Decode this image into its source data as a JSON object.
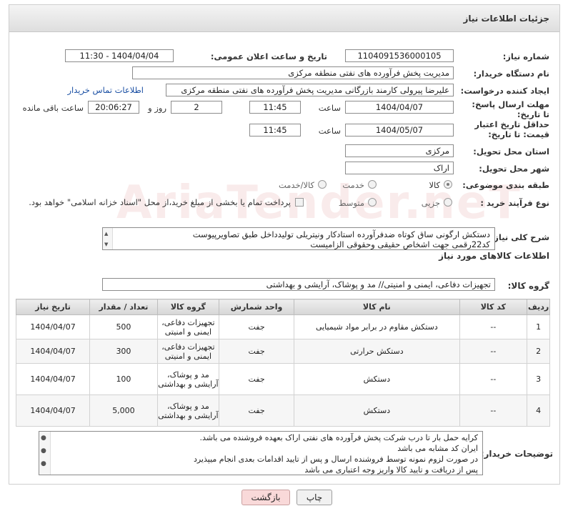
{
  "header": {
    "title": "جزئیات اطلاعات نیاز"
  },
  "fields": {
    "need_number_label": "شماره نیاز:",
    "need_number": "1104091536000105",
    "announce_label": "تاریخ و ساعت اعلان عمومی:",
    "announce_value": "1404/04/04 - 11:30",
    "buyer_org_label": "نام دستگاه خریدار:",
    "buyer_org": "مدیریت پخش فرآورده های نفتی منطقه مرکزی",
    "creator_label": "ایجاد کننده درخواست:",
    "creator": "علیرضا پیرولی کارمند بازرگانی مدیریت پخش فرآورده های نفتی منطقه مرکزی",
    "contact_link": "اطلاعات تماس خریدار",
    "reply_deadline_label": "مهلت ارسال پاسخ: تا تاریخ:",
    "reply_date": "1404/04/07",
    "time_label": "ساعت",
    "reply_time": "11:45",
    "days_value": "2",
    "days_label": "روز و",
    "remaining_time": "20:06:27",
    "remaining_label": "ساعت باقی مانده",
    "price_deadline_label": "حداقل تاریخ اعتبار قیمت: تا تاریخ:",
    "price_date": "1404/05/07",
    "price_time": "11:45",
    "province_label": "استان محل تحویل:",
    "province": "مرکزی",
    "city_label": "شهر محل تحویل:",
    "city": "اراک",
    "category_label": "طبقه بندی موضوعی:",
    "category_options": [
      "کالا",
      "خدمت",
      "کالا/خدمت"
    ],
    "purchase_type_label": "نوع فرآیند خرید :",
    "purchase_options": [
      "جزیی",
      "متوسط"
    ],
    "payment_note": "پرداخت تمام یا بخشی از مبلغ خرید،از محل \"اسناد خزانه اسلامی\" خواهد بود.",
    "summary_label": "شرح کلی نیاز:",
    "summary_line1": "دستکش ارگونی ساق کوتاه ضدفرآورده استادکار ونیتریلی تولیدداخل طبق تصاویرپیوست",
    "summary_line2": "کد22رقمی  جهت اشخاص حقیقی وحقوقی الزامیست",
    "goods_info_title": "اطلاعات کالاهای مورد نیاز",
    "goods_group_label": "گروه کالا:",
    "goods_group": "تجهیزات دفاعی، ایمنی و امنیتی// مد و پوشاک، آرایشی و بهداشتی"
  },
  "table": {
    "headers": [
      "ردیف",
      "کد کالا",
      "نام کالا",
      "واحد شمارش",
      "گروه کالا",
      "تعداد / مقدار",
      "تاریخ نیاز"
    ],
    "rows": [
      {
        "idx": "1",
        "code": "--",
        "name": "دستکش مقاوم در برابر مواد شیمیایی",
        "unit": "جفت",
        "group": "تجهیزات دفاعی، ایمنی و امنیتی",
        "qty": "500",
        "date": "1404/04/07"
      },
      {
        "idx": "2",
        "code": "--",
        "name": "دستکش حرارتی",
        "unit": "جفت",
        "group": "تجهیزات دفاعی، ایمنی و امنیتی",
        "qty": "300",
        "date": "1404/04/07"
      },
      {
        "idx": "3",
        "code": "--",
        "name": "دستکش",
        "unit": "جفت",
        "group": "مد و پوشاک، آرایشی و بهداشتی",
        "qty": "100",
        "date": "1404/04/07"
      },
      {
        "idx": "4",
        "code": "--",
        "name": "دستکش",
        "unit": "جفت",
        "group": "مد و پوشاک، آرایشی و بهداشتی",
        "qty": "5,000",
        "date": "1404/04/07"
      }
    ]
  },
  "notes": {
    "label": "توضیحات خریدار:",
    "lines": [
      "کرایه حمل بار تا درب شرکت  پخش فرآورده های نفتی اراک بعهده فروشنده می باشد.",
      "ایران کد مشابه می باشد",
      "در صورت لزوم نمونه توسط فروشنده ارسال و پس از تایید اقدامات بعدی انجام میپذیرد",
      "پس از دریافت و تایید کالا واریز وجه اعتباری می باشد"
    ]
  },
  "buttons": {
    "print": "چاپ",
    "back": "بازگشت"
  },
  "watermark": "AriaTender.neT",
  "colors": {
    "link": "#1a4fa3",
    "back_button": "#f9d9d9",
    "print_button": "#f1f1f1"
  }
}
